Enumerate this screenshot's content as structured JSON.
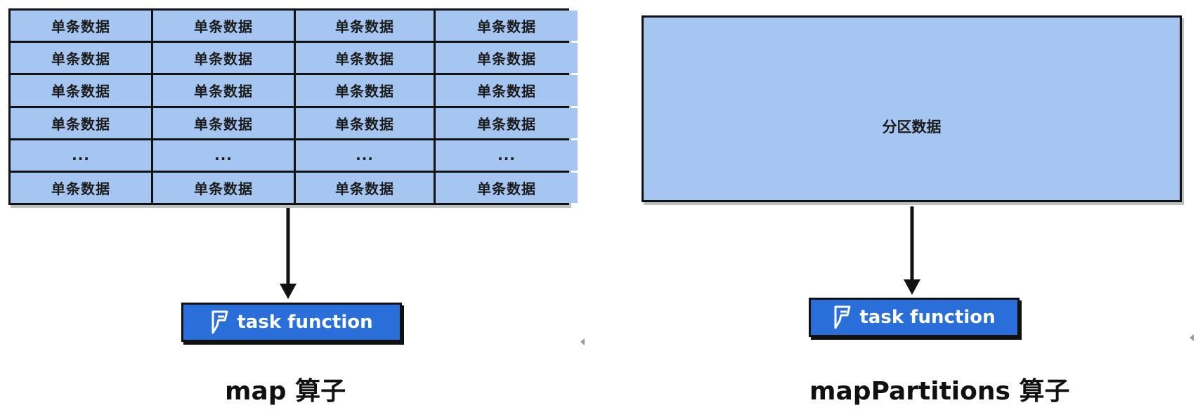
{
  "map_panel": {
    "grid_rows": [
      [
        "单条数据",
        "单条数据",
        "单条数据",
        "单条数据"
      ],
      [
        "单条数据",
        "单条数据",
        "单条数据",
        "单条数据"
      ],
      [
        "单条数据",
        "单条数据",
        "单条数据",
        "单条数据"
      ],
      [
        "单条数据",
        "单条数据",
        "单条数据",
        "单条数据"
      ],
      [
        "...",
        "...",
        "...",
        "..."
      ],
      [
        "单条数据",
        "单条数据",
        "单条数据",
        "单条数据"
      ]
    ],
    "task_label": "task function",
    "task_icon": "foursquare-icon",
    "caption": "map 算子"
  },
  "mappartitions_panel": {
    "block_label": "分区数据",
    "task_label": "task function",
    "task_icon": "foursquare-icon",
    "caption": "mapPartitions 算子"
  },
  "colors": {
    "cell_fill": "#a6c6f2",
    "button_fill": "#2a6fd9",
    "border": "#111111"
  }
}
